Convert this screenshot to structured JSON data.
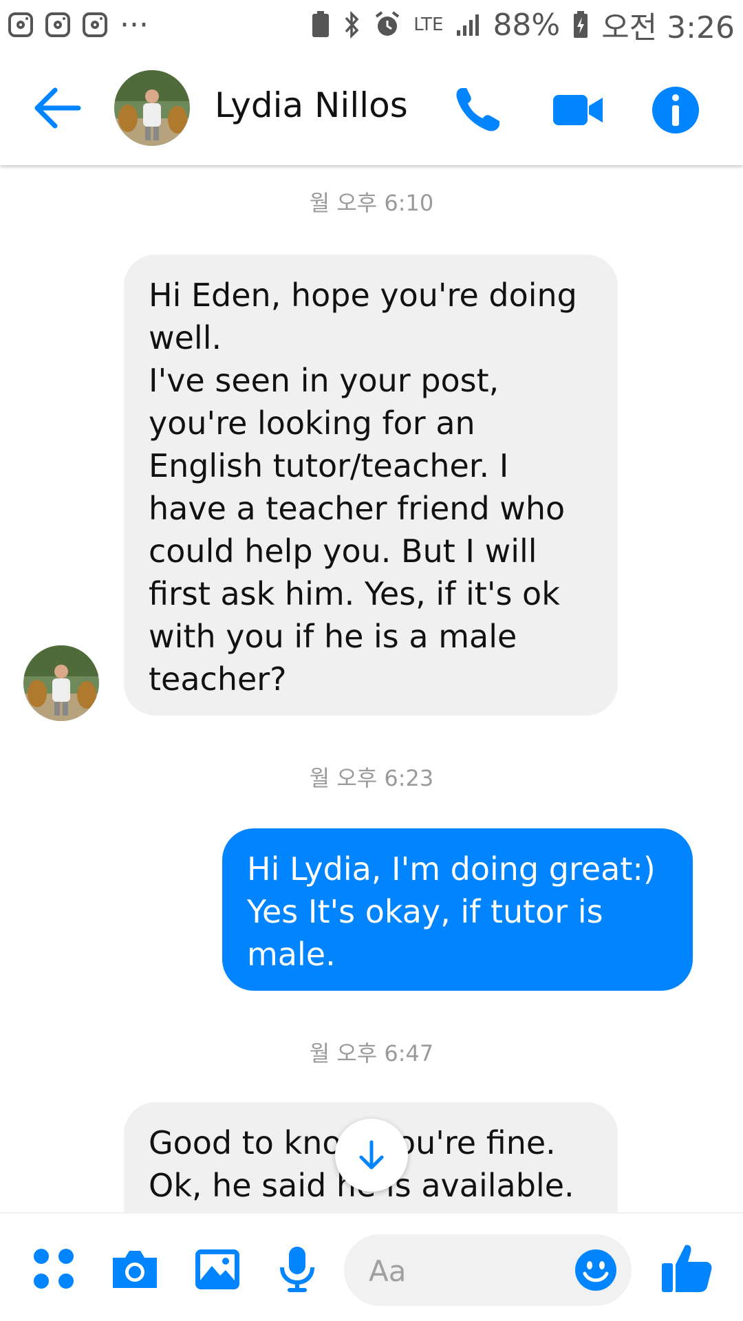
{
  "status_bar": {
    "battery_percent": "88%",
    "time": "오전 3:26",
    "network": "LTE",
    "more": "···"
  },
  "header": {
    "contact_name": "Lydia Nillos"
  },
  "messages": [
    {
      "timestamp": "월 오후 6:10",
      "direction": "incoming",
      "text": "Hi Eden, hope you're doing\nwell.\nI've seen in your post,\nyou're looking for an\nEnglish tutor/teacher. I\nhave a teacher friend who\ncould help you. But I will\nfirst ask him. Yes, if it's ok\nwith you if he is a male\nteacher?"
    },
    {
      "timestamp": "월 오후 6:23",
      "direction": "outgoing",
      "text": "Hi Lydia, I'm doing great:)\nYes It's okay, if tutor is\nmale."
    },
    {
      "timestamp": "월 오후 6:47",
      "direction": "incoming",
      "text": "Good to know you're fine.\nOk, he said he is available."
    }
  ],
  "composer": {
    "placeholder": "Aa"
  },
  "colors": {
    "accent": "#0084ff",
    "incoming_bubble": "#f0f0f0",
    "timestamp": "#9a9a9a"
  },
  "icons": {
    "back": "arrow-left-icon",
    "call": "phone-icon",
    "video": "video-camera-icon",
    "info": "info-icon",
    "apps": "four-dots-icon",
    "camera": "camera-icon",
    "gallery": "image-icon",
    "mic": "microphone-icon",
    "emoji": "smiley-icon",
    "like": "thumbs-up-icon",
    "scroll": "arrow-down-icon"
  }
}
